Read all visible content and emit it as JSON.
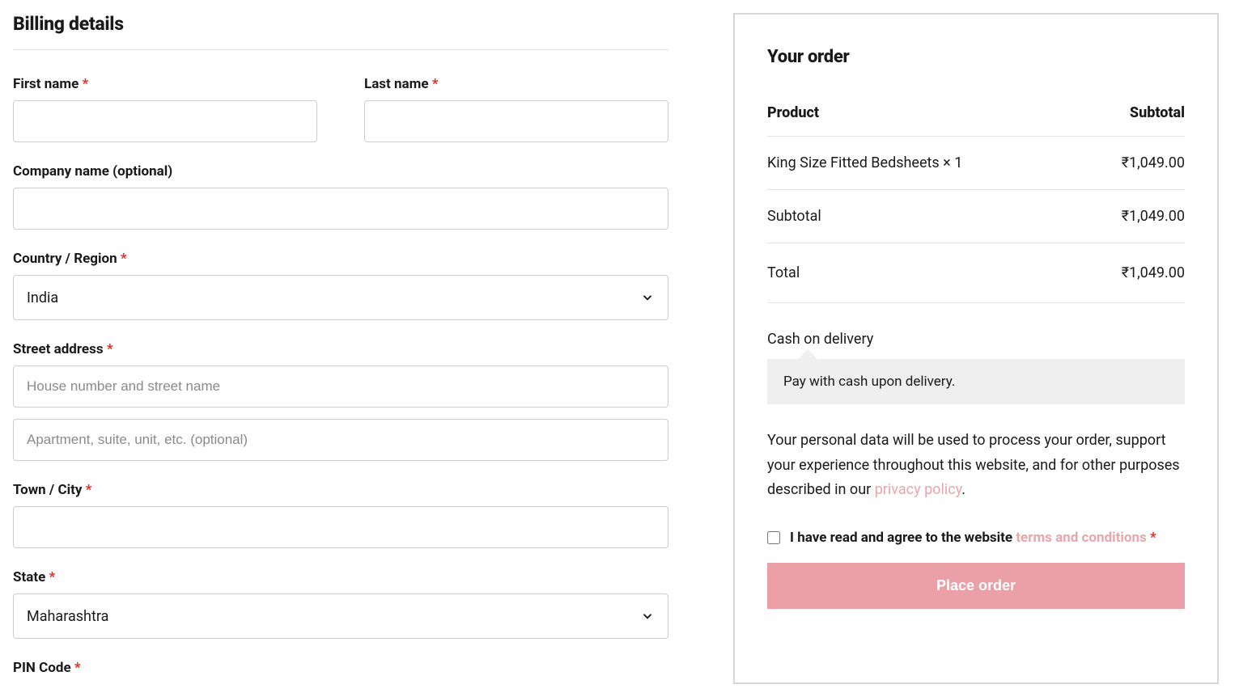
{
  "billing": {
    "heading": "Billing details",
    "first_name_label": "First name",
    "last_name_label": "Last name",
    "company_label": "Company name (optional)",
    "country_label": "Country / Region",
    "country_value": "India",
    "street_label": "Street address",
    "street1_placeholder": "House number and street name",
    "street2_placeholder": "Apartment, suite, unit, etc. (optional)",
    "city_label": "Town / City",
    "state_label": "State",
    "state_value": "Maharashtra",
    "pin_label": "PIN Code"
  },
  "order": {
    "heading": "Your order",
    "product_col": "Product",
    "subtotal_col": "Subtotal",
    "product_line": "King Size Fitted Bedsheets  × 1",
    "product_price": "₹1,049.00",
    "subtotal_label": "Subtotal",
    "subtotal_value": "₹1,049.00",
    "total_label": "Total",
    "total_value": "₹1,049.00",
    "payment_method": "Cash on delivery",
    "payment_description": "Pay with cash upon delivery.",
    "privacy_text_prefix": "Your personal data will be used to process your order, support your experience throughout this website, and for other purposes described in our ",
    "privacy_link_text": "privacy policy",
    "period": ".",
    "terms_prefix": "I have read and agree to the website ",
    "terms_link_text": "terms and conditions",
    "required_mark": "*",
    "place_order_label": "Place order"
  }
}
